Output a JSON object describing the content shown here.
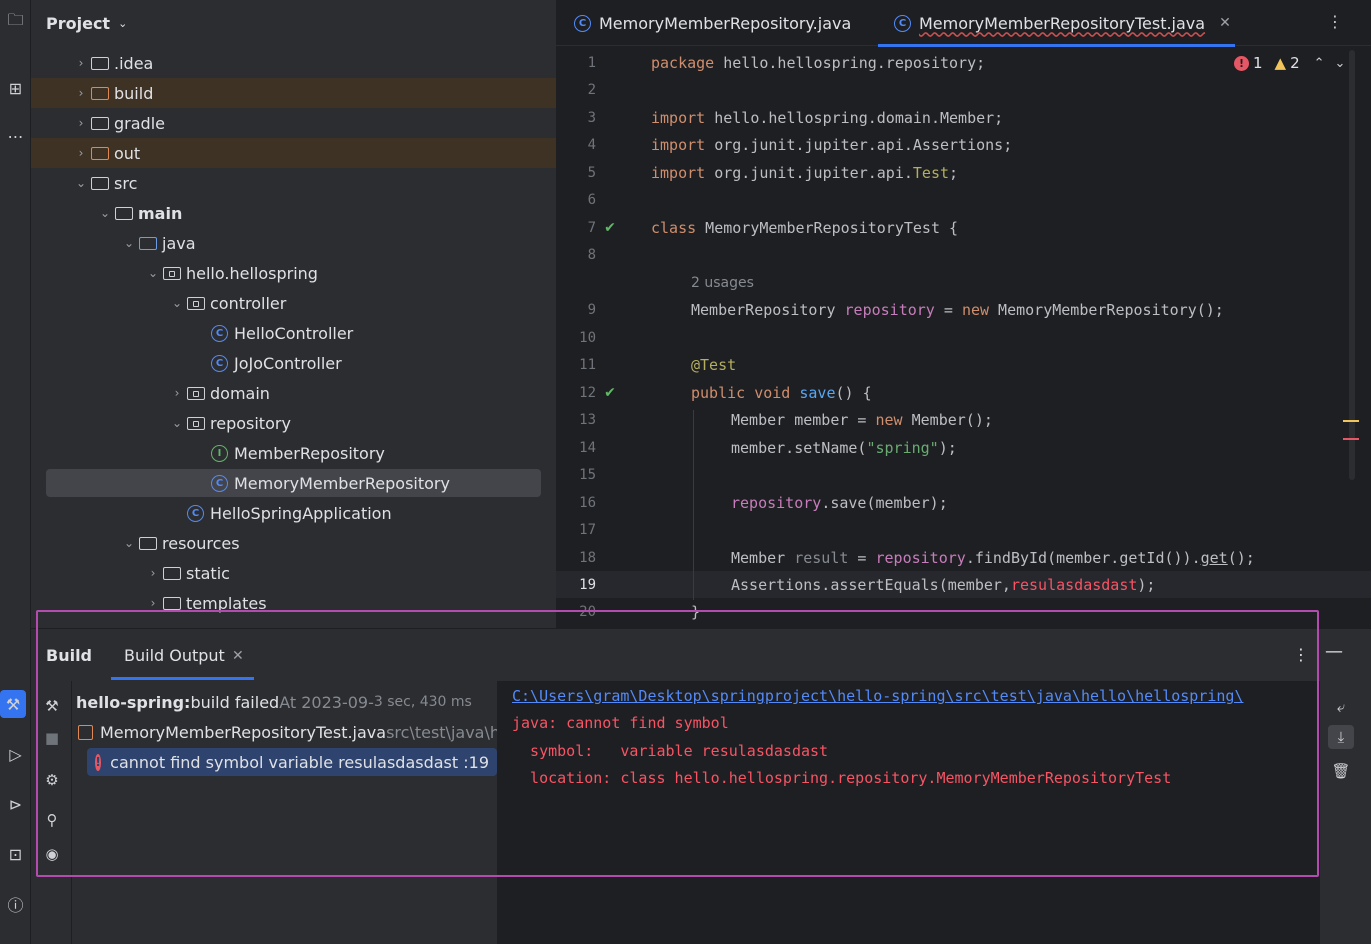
{
  "project_panel": {
    "title": "Project",
    "tree": [
      {
        "label": ".idea",
        "arrow": "›",
        "kind": "folder"
      },
      {
        "label": "build",
        "arrow": "›",
        "kind": "folder-excluded"
      },
      {
        "label": "gradle",
        "arrow": "›",
        "kind": "folder"
      },
      {
        "label": "out",
        "arrow": "›",
        "kind": "folder-excluded"
      },
      {
        "label": "src",
        "arrow": "⌄",
        "kind": "folder"
      },
      {
        "label": "main",
        "arrow": "⌄",
        "kind": "source-root"
      },
      {
        "label": "java",
        "arrow": "⌄",
        "kind": "folder-blue"
      },
      {
        "label": "hello.hellospring",
        "arrow": "⌄",
        "kind": "package"
      },
      {
        "label": "controller",
        "arrow": "⌄",
        "kind": "package"
      },
      {
        "label": "HelloController",
        "arrow": "",
        "kind": "class"
      },
      {
        "label": "JoJoController",
        "arrow": "",
        "kind": "class"
      },
      {
        "label": "domain",
        "arrow": "›",
        "kind": "package"
      },
      {
        "label": "repository",
        "arrow": "⌄",
        "kind": "package"
      },
      {
        "label": "MemberRepository",
        "arrow": "",
        "kind": "interface"
      },
      {
        "label": "MemoryMemberRepository",
        "arrow": "",
        "kind": "class"
      },
      {
        "label": "HelloSpringApplication",
        "arrow": "",
        "kind": "class"
      },
      {
        "label": "resources",
        "arrow": "⌄",
        "kind": "resources"
      },
      {
        "label": "static",
        "arrow": "›",
        "kind": "folder"
      },
      {
        "label": "templates",
        "arrow": "›",
        "kind": "folder"
      }
    ]
  },
  "editor": {
    "tabs": [
      {
        "label": "MemoryMemberRepository.java"
      },
      {
        "label": "MemoryMemberRepositoryTest.java"
      }
    ],
    "inspection": {
      "errors": "1",
      "warnings": "2"
    },
    "usages_hint": "2 usages",
    "line_numbers": [
      "1",
      "2",
      "3",
      "4",
      "5",
      "6",
      "7",
      "8",
      "9",
      "10",
      "11",
      "12",
      "13",
      "14",
      "15",
      "16",
      "17",
      "18",
      "19",
      "20"
    ],
    "current_line": "19",
    "code": {
      "l1_kw": "package",
      "l1_rest": " hello.hellospring.repository;",
      "l3_kw": "import",
      "l3_rest": " hello.hellospring.domain.Member;",
      "l4_kw": "import",
      "l4_rest": " org.junit.jupiter.api.Assertions;",
      "l5_kw": "import",
      "l5_a": " org.junit.jupiter.api.",
      "l5_b": "Test",
      "l5_c": ";",
      "l7_kw": "class",
      "l7_rest": " MemoryMemberRepositoryTest {",
      "l9_a": "MemberRepository ",
      "l9_fld": "repository",
      "l9_b": " = ",
      "l9_kw": "new",
      "l9_c": " MemoryMemberRepository();",
      "l11_ann": "@Test",
      "l12_kw": "public void",
      "l12_sp": " ",
      "l12_fn": "save",
      "l12_rest": "() {",
      "l13_a": "Member member = ",
      "l13_kw": "new",
      "l13_b": " Member();",
      "l14_a": "member.setName(",
      "l14_str": "\"spring\"",
      "l14_b": ");",
      "l16_fld": "repository",
      "l16_rest": ".save(member);",
      "l18_a": "Member ",
      "l18_dim": "result",
      "l18_b": " = ",
      "l18_fld": "repository",
      "l18_c": ".findById(member.getId()).",
      "l18_get": "get",
      "l18_d": "();",
      "l19_a": "Assertions.assertEquals(member,",
      "l19_err": "resulasdasdast",
      "l19_b": ");",
      "l20_a": "}"
    }
  },
  "build": {
    "title": "Build",
    "tab": "Build Output",
    "tree": {
      "root_bold": "hello-spring:",
      "root_status": " build failed",
      "root_time": " At 2023-09-",
      "root_duration": " 3 sec, 430 ms",
      "file_name": "MemoryMemberRepositoryTest.java",
      "file_path": " src\\test\\java\\he",
      "error_label": "cannot find symbol variable resulasdasdast :19"
    },
    "output": {
      "path": "C:\\Users\\gram\\Desktop\\springproject\\hello-spring\\src\\test\\java\\hello\\hellospring\\",
      "line1": "java: cannot find symbol",
      "line2": "  symbol:   variable resulasdasdast",
      "line3": "  location: class hello.hellospring.repository.MemoryMemberRepositoryTest"
    }
  },
  "colors": {
    "accent": "#3574f0",
    "error": "#f75464",
    "highlight_border": "#b44cb0"
  }
}
